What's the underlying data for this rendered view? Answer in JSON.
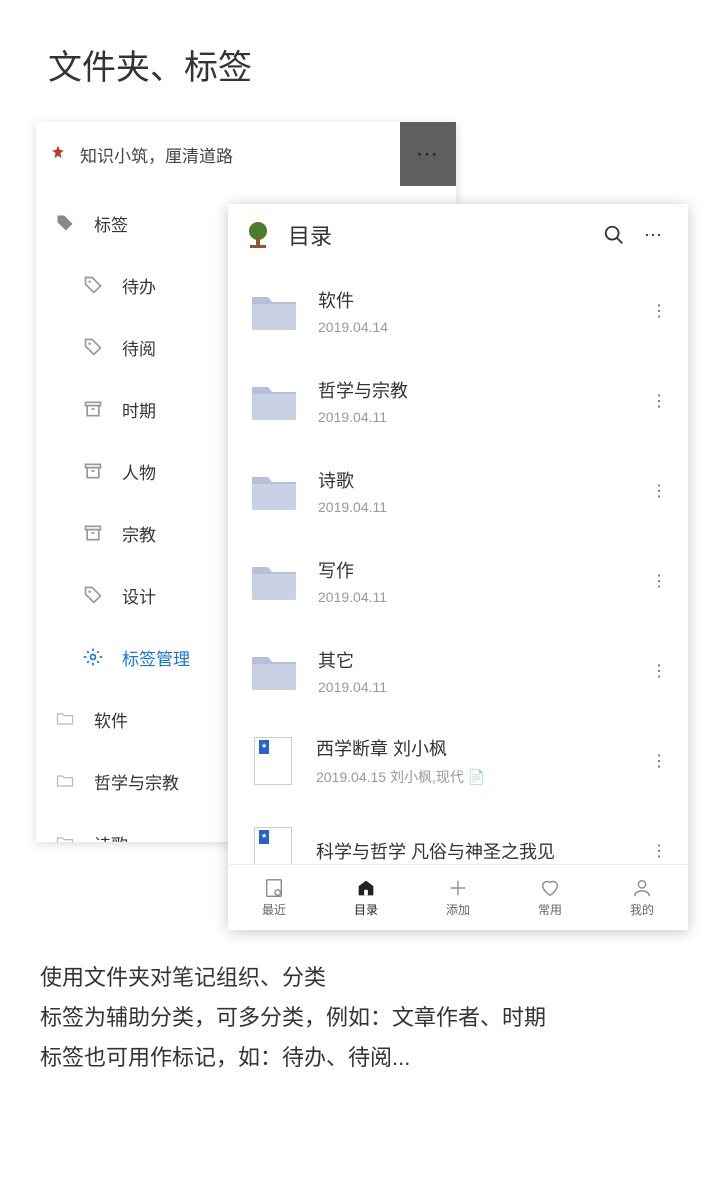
{
  "page_title": "文件夹、标签",
  "back_panel": {
    "subtitle": "知识小筑，厘清道路",
    "root_label": "标签",
    "items": [
      {
        "label": "待办",
        "icon": "tag"
      },
      {
        "label": "待阅",
        "icon": "tag"
      },
      {
        "label": "时期",
        "icon": "archive"
      },
      {
        "label": "人物",
        "icon": "archive"
      },
      {
        "label": "宗教",
        "icon": "archive"
      },
      {
        "label": "设计",
        "icon": "tag"
      },
      {
        "label": "标签管理",
        "icon": "gear",
        "blue": true
      }
    ],
    "folders": [
      {
        "label": "软件"
      },
      {
        "label": "哲学与宗教"
      },
      {
        "label": "诗歌"
      }
    ]
  },
  "front_panel": {
    "title": "目录",
    "items": [
      {
        "type": "folder",
        "name": "软件",
        "date": "2019.04.14"
      },
      {
        "type": "folder",
        "name": "哲学与宗教",
        "date": "2019.04.11"
      },
      {
        "type": "folder",
        "name": "诗歌",
        "date": "2019.04.11"
      },
      {
        "type": "folder",
        "name": "写作",
        "date": "2019.04.11"
      },
      {
        "type": "folder",
        "name": "其它",
        "date": "2019.04.11"
      },
      {
        "type": "doc",
        "name": "西学断章  刘小枫",
        "date": "2019.04.15 刘小枫,现代 📄"
      },
      {
        "type": "doc",
        "name": "科学与哲学  凡俗与神圣之我见",
        "date": ""
      }
    ],
    "tabs": [
      {
        "label": "最近",
        "icon": "recent"
      },
      {
        "label": "目录",
        "icon": "catalog",
        "active": true
      },
      {
        "label": "添加",
        "icon": "add"
      },
      {
        "label": "常用",
        "icon": "heart"
      },
      {
        "label": "我的",
        "icon": "user"
      }
    ]
  },
  "bottom": {
    "line1": "使用文件夹对笔记组织、分类",
    "line2": "标签为辅助分类，可多分类，例如：文章作者、时期",
    "line3": "标签也可用作标记，如：待办、待阅..."
  }
}
